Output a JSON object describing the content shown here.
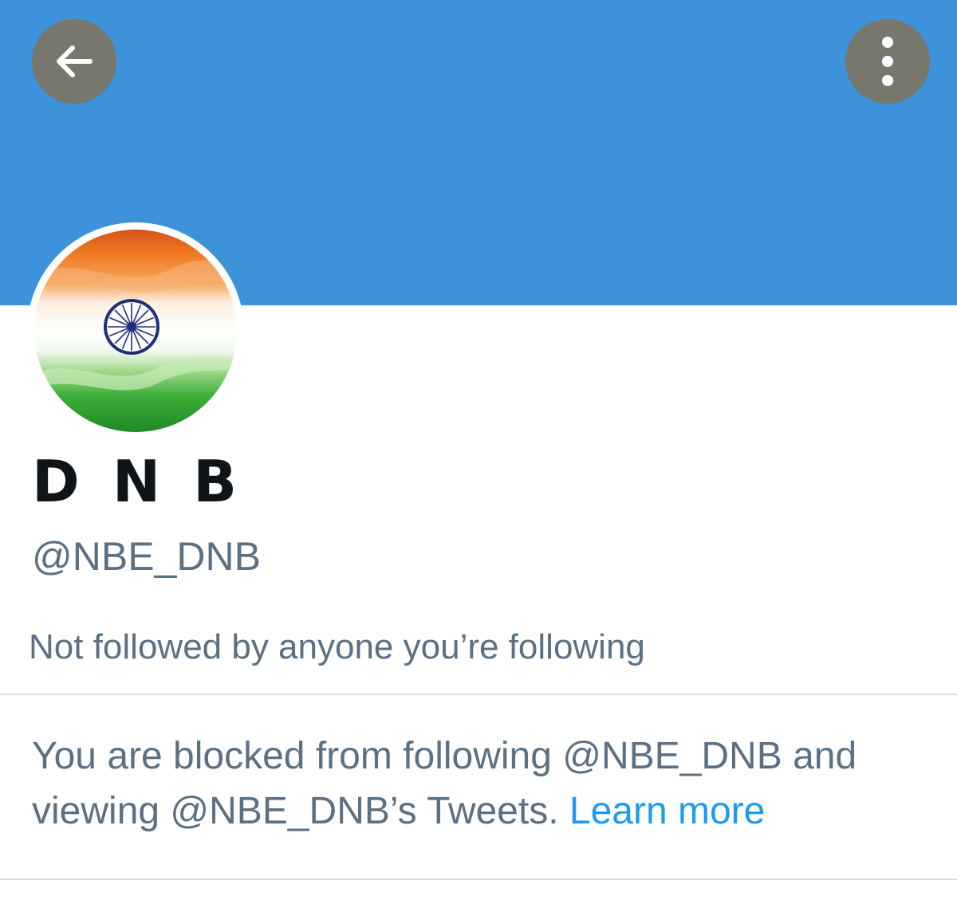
{
  "header": {
    "banner_color": "#3d92d9",
    "back_icon": "arrow-left-icon",
    "more_icon": "more-vertical-icon"
  },
  "profile": {
    "avatar_description": "indian-flag-avatar",
    "display_name": "D N B",
    "handle": "@NBE_DNB",
    "followers_you_know": "Not followed by anyone you’re following"
  },
  "blocked": {
    "message": "You are blocked from following @NBE_DNB and viewing @NBE_DNB’s Tweets.",
    "learn_more": "Learn more",
    "link_color": "#1d9bf0"
  }
}
